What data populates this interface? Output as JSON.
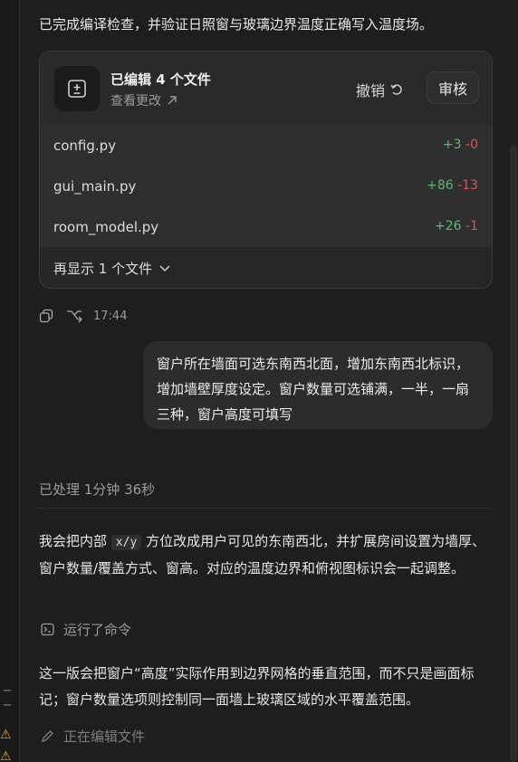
{
  "intro": "已完成编译检查，并验证日照窗与玻璃边界温度正确写入温度场。",
  "changes_card": {
    "title": "已编辑 4 个文件",
    "view_changes": "查看更改",
    "undo_label": "撤销",
    "review_label": "审核",
    "files": [
      {
        "name": "config.py",
        "added": "+3",
        "removed": "-0"
      },
      {
        "name": "gui_main.py",
        "added": "+86",
        "removed": "-13"
      },
      {
        "name": "room_model.py",
        "added": "+26",
        "removed": "-1"
      }
    ],
    "show_more": "再显示 1 个文件"
  },
  "message_meta": {
    "time": "17:44"
  },
  "user_message": "窗户所在墙面可选东南西北面，增加东南西北标识，增加墙壁厚度设定。窗户数量可选铺满，一半，一扇三种，窗户高度可填写",
  "processed_label": "已处理 1分钟 36秒",
  "reply": {
    "part1": "我会把内部",
    "code": "x/y",
    "part2": "方位改成用户可见的东南西北，并扩展房间设置为墙厚、窗户数量/覆盖方式、窗高。对应的温度边界和俯视图标识会一起调整。"
  },
  "ran_command_label": "运行了命令",
  "reply2": "这一版会把窗户“高度”实际作用到边界网格的垂直范围，而不只是画面标记；窗户数量选项则控制同一面墙上玻璃区域的水平覆盖范围。",
  "editing_label": "正在编辑文件",
  "colors": {
    "added": "#5fb872",
    "removed": "#d35a5a",
    "background": "#1e1e1e"
  }
}
